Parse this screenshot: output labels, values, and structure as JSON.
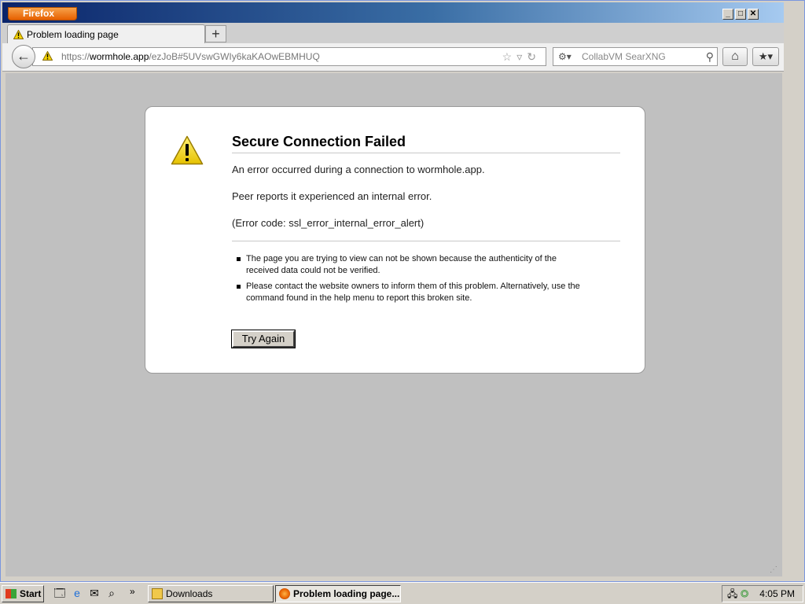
{
  "window": {
    "app_menu_label": "Firefox",
    "controls": {
      "minimize": "_",
      "maximize": "□",
      "close": "✕"
    }
  },
  "tab": {
    "title": "Problem loading page",
    "new_tab_label": "+"
  },
  "navbar": {
    "url_prefix": "https://",
    "url_host": "wormhole.app",
    "url_path": "/ezJoB#5UVswGWIy6kaKAOwEBMHUQ",
    "search_placeholder": "CollabVM SearXNG"
  },
  "error": {
    "title": "Secure Connection Failed",
    "line1": "An error occurred during a connection to wormhole.app.",
    "line2": "Peer reports it experienced an internal error.",
    "line3": "(Error code: ssl_error_internal_error_alert)",
    "bullets": [
      "The page you are trying to view can not be shown because the authenticity of the received data could not be verified.",
      "Please contact the website owners to inform them of this problem. Alternatively, use the command found in the help menu to report this broken site."
    ],
    "try_again_label": "Try Again"
  },
  "taskbar": {
    "start_label": "Start",
    "more_label": "»",
    "items": [
      {
        "label": "Downloads"
      },
      {
        "label": "Problem loading page..."
      }
    ],
    "clock": "4:05 PM"
  },
  "colors": {
    "content_bg": "#c0c0c0",
    "warning_yellow": "#f5d400",
    "firefox_orange": "#e66000"
  }
}
